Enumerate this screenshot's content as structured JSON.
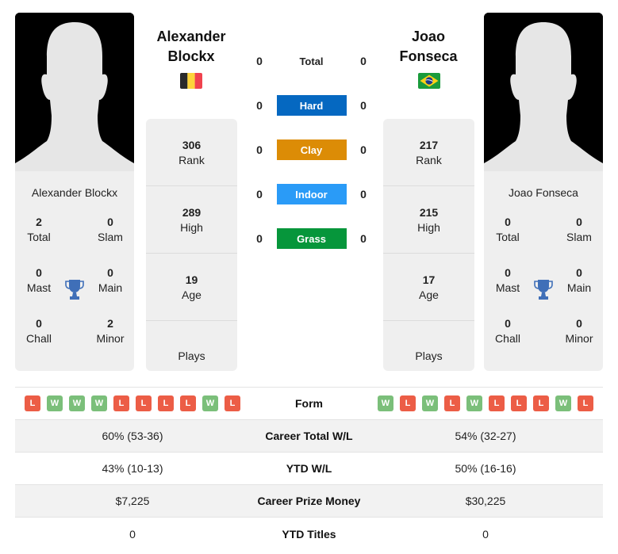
{
  "colors": {
    "hard": "#0568c1",
    "clay": "#dc8c06",
    "indoor": "#2a9bf7",
    "grass": "#06963b",
    "win": "#7bbf7a",
    "loss": "#ec5d46",
    "trophy": "#3f6fb8"
  },
  "player1": {
    "name_line1": "Alexander",
    "name_line2": "Blockx",
    "full_name": "Alexander Blockx",
    "flag": "Belgium",
    "titles": {
      "total": "2",
      "total_label": "Total",
      "slam": "0",
      "slam_label": "Slam",
      "mast": "0",
      "mast_label": "Mast",
      "main": "0",
      "main_label": "Main",
      "chall": "0",
      "chall_label": "Chall",
      "minor": "2",
      "minor_label": "Minor"
    },
    "info": {
      "rank": "306",
      "rank_label": "Rank",
      "high": "289",
      "high_label": "High",
      "age": "19",
      "age_label": "Age",
      "plays_label": "Plays"
    },
    "form": [
      "L",
      "W",
      "W",
      "W",
      "L",
      "L",
      "L",
      "L",
      "W",
      "L"
    ],
    "career_wl": "60% (53-36)",
    "ytd_wl": "43% (10-13)",
    "prize": "$7,225",
    "ytd_titles": "0"
  },
  "player2": {
    "name_line1": "Joao",
    "name_line2": "Fonseca",
    "full_name": "Joao Fonseca",
    "flag": "Brazil",
    "titles": {
      "total": "0",
      "total_label": "Total",
      "slam": "0",
      "slam_label": "Slam",
      "mast": "0",
      "mast_label": "Mast",
      "main": "0",
      "main_label": "Main",
      "chall": "0",
      "chall_label": "Chall",
      "minor": "0",
      "minor_label": "Minor"
    },
    "info": {
      "rank": "217",
      "rank_label": "Rank",
      "high": "215",
      "high_label": "High",
      "age": "17",
      "age_label": "Age",
      "plays_label": "Plays"
    },
    "form": [
      "W",
      "L",
      "W",
      "L",
      "W",
      "L",
      "L",
      "L",
      "W",
      "L"
    ],
    "career_wl": "54% (32-27)",
    "ytd_wl": "50% (16-16)",
    "prize": "$30,225",
    "ytd_titles": "0"
  },
  "h2h": [
    {
      "label": "Total",
      "p1": "0",
      "p2": "0",
      "surface": "total"
    },
    {
      "label": "Hard",
      "p1": "0",
      "p2": "0",
      "surface": "hard"
    },
    {
      "label": "Clay",
      "p1": "0",
      "p2": "0",
      "surface": "clay"
    },
    {
      "label": "Indoor",
      "p1": "0",
      "p2": "0",
      "surface": "indoor"
    },
    {
      "label": "Grass",
      "p1": "0",
      "p2": "0",
      "surface": "grass"
    }
  ],
  "comparison": {
    "form_label": "Form",
    "career_wl_label": "Career Total W/L",
    "ytd_wl_label": "YTD W/L",
    "prize_label": "Career Prize Money",
    "ytd_titles_label": "YTD Titles"
  }
}
